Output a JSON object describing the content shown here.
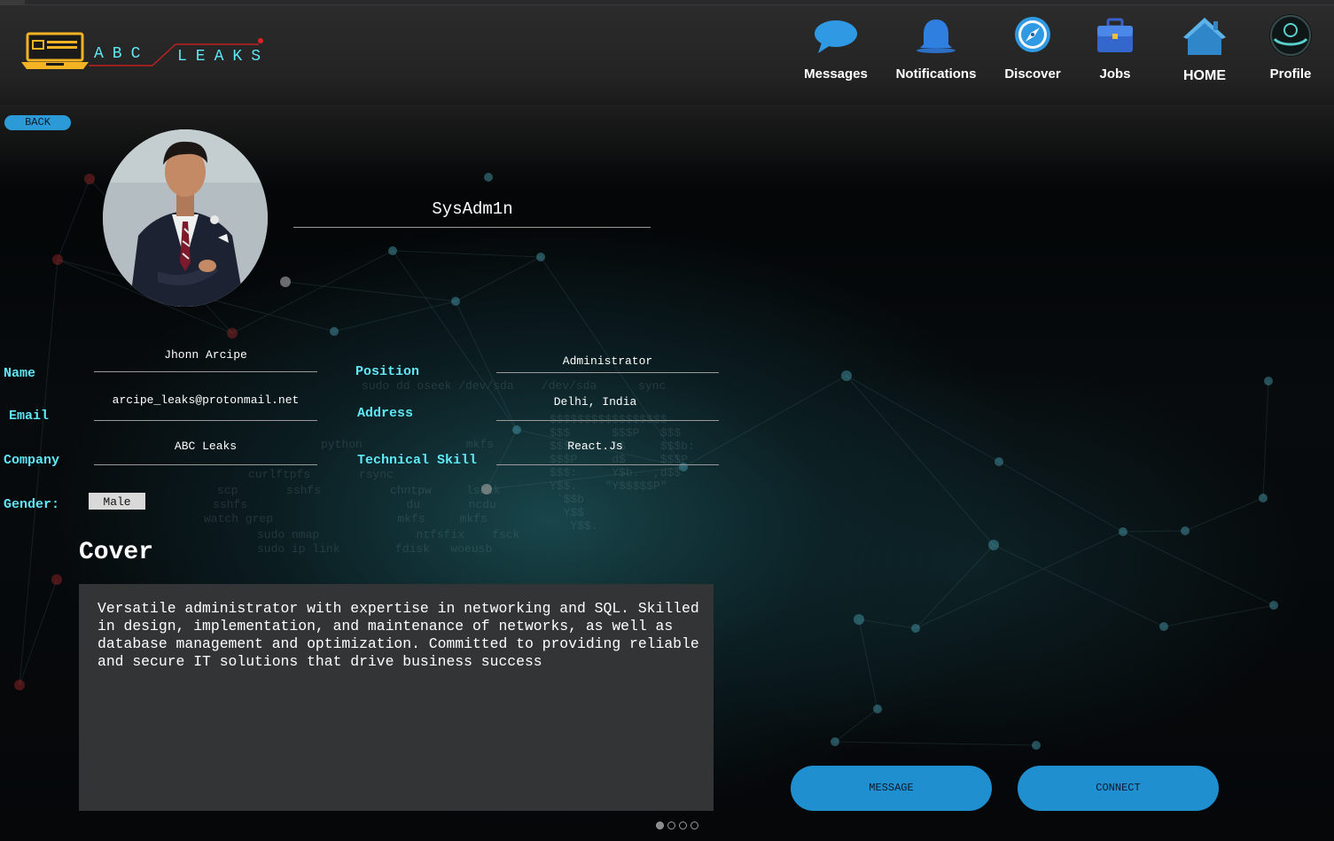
{
  "brand": {
    "name_left": "ABC",
    "name_right": "LEAKS"
  },
  "nav": {
    "messages": "Messages",
    "notifications": "Notifications",
    "discover": "Discover",
    "jobs": "Jobs",
    "home": "HOME",
    "profile": "Profile"
  },
  "back_label": "BACK",
  "profile": {
    "username": "SysAdm1n",
    "labels": {
      "name": "Name",
      "email": "Email",
      "company": "Company",
      "gender": "Gender:",
      "position": "Position",
      "address": "Address",
      "technical_skill": "Technical Skill"
    },
    "values": {
      "name": "Jhonn Arcipe",
      "email": "arcipe_leaks@protonmail.net",
      "company": "ABC Leaks",
      "gender": "Male",
      "position": "Administrator",
      "address": "Delhi, India",
      "technical_skill": "React.Js"
    }
  },
  "cover": {
    "title": "Cover",
    "text": "Versatile administrator with expertise in networking and SQL. Skilled in design, implementation, and maintenance of networks, as well as database management and optimization. Committed to providing reliable and secure IT solutions that drive business success"
  },
  "pagination": {
    "count": 4,
    "active": 1
  },
  "actions": {
    "message": "MESSAGE",
    "connect": "CONNECT"
  },
  "colors": {
    "accent_cyan": "#5fe8f5",
    "button_blue": "#1f8fd0",
    "header_bg": "#262626"
  },
  "icons": {
    "messages": "chat-bubble-icon",
    "notifications": "bell-icon",
    "discover": "compass-icon",
    "jobs": "briefcase-icon",
    "home": "house-icon",
    "profile": "avatar-icon",
    "logo": "laptop-logo-icon"
  }
}
